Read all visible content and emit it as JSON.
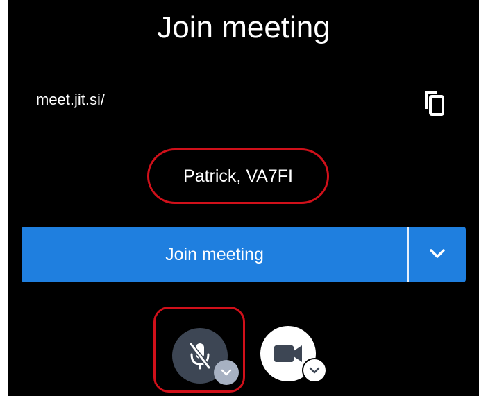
{
  "prejoin": {
    "title": "Join meeting",
    "meeting_url": "meet.jit.si/",
    "copy_icon": "copy-icon",
    "name_input": {
      "value": "Patrick, VA7FI"
    },
    "join_button": {
      "label": "Join meeting",
      "options_icon": "chevron-down-icon"
    },
    "controls": {
      "mic_icon": "microphone-off-icon",
      "mic_options_icon": "chevron-down-icon",
      "camera_icon": "camera-icon",
      "camera_options_icon": "chevron-down-icon"
    }
  },
  "colors": {
    "background": "#000000",
    "primary": "#1f7fdf",
    "highlight": "#d0101a",
    "mic_button": "#3d4654",
    "mic_arrow": "#a7b1c2",
    "text": "#ffffff"
  }
}
